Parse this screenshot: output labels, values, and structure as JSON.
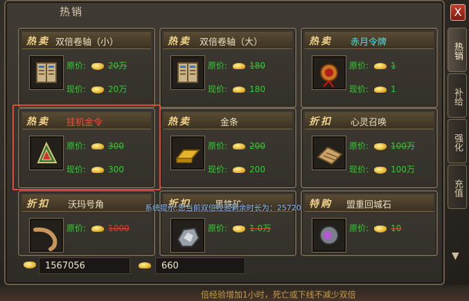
{
  "window": {
    "title": "热销",
    "close_label": "X"
  },
  "side_tabs": [
    "热销",
    "补给",
    "强化",
    "充值"
  ],
  "cards": [
    {
      "tag": "热卖",
      "name": "双倍卷轴（小）",
      "name_color": "normal",
      "orig_label": "原价:",
      "orig_price": "20万",
      "cur_label": "现价:",
      "cur_price": "20万",
      "icon": "scroll-book-icon",
      "currency": "gold"
    },
    {
      "tag": "热卖",
      "name": "双倍卷轴（大）",
      "name_color": "normal",
      "orig_label": "原价:",
      "orig_price": "180",
      "cur_label": "现价:",
      "cur_price": "180",
      "icon": "scroll-book-icon",
      "currency": "yuanbao"
    },
    {
      "tag": "热卖",
      "name": "赤月令牌",
      "name_color": "cyan",
      "orig_label": "原价:",
      "orig_price": "1",
      "cur_label": "现价:",
      "cur_price": "1",
      "icon": "red-token-icon",
      "currency": "yuanbao"
    },
    {
      "tag": "热卖",
      "name": "挂机金令",
      "name_color": "red",
      "orig_label": "原价:",
      "orig_price": "300",
      "cur_label": "现价:",
      "cur_price": "300",
      "icon": "triangle-token-icon",
      "currency": "yuanbao"
    },
    {
      "tag": "热卖",
      "name": "金条",
      "name_color": "normal",
      "orig_label": "原价:",
      "orig_price": "200",
      "cur_label": "现价:",
      "cur_price": "200",
      "icon": "gold-bar-icon",
      "currency": "yuanbao"
    },
    {
      "tag": "折扣",
      "name": "心灵召唤",
      "name_color": "normal",
      "orig_label": "原价:",
      "orig_price": "100万",
      "cur_label": "现价:",
      "cur_price": "100万",
      "icon": "summon-tablet-icon",
      "currency": "gold"
    },
    {
      "tag": "折扣",
      "name": "沃玛号角",
      "name_color": "normal",
      "orig_label": "原价:",
      "orig_price": "1000",
      "icon": "horn-icon",
      "currency": "yuanbao"
    },
    {
      "tag": "折扣",
      "name": "黑铁矿",
      "name_color": "normal",
      "orig_label": "原价:",
      "orig_price": "1.0万",
      "icon": "black-iron-ore-icon",
      "currency": "gold"
    },
    {
      "tag": "特购",
      "name": "盟重回城石",
      "name_color": "normal",
      "orig_label": "原价:",
      "orig_price": "10",
      "icon": "return-stone-icon",
      "currency": "gold"
    }
  ],
  "wallet": {
    "gold": "1567056",
    "yuanbao": "660"
  },
  "system_message": "系统提示:您当前双倍经验剩余时长为：25720",
  "footer_text": "倍经验增加1小时，死亡或下线不减少双倍"
}
